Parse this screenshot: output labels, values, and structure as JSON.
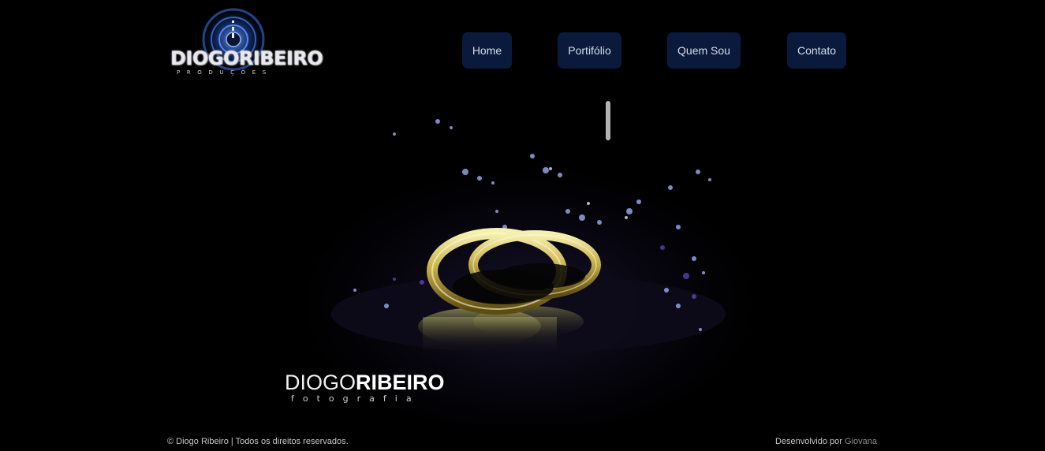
{
  "header": {
    "logo": {
      "wordmark": "DIOGORIBEIRO",
      "subtitle": "PRODUÇÕES"
    },
    "nav": [
      {
        "label": "Home"
      },
      {
        "label": "Portifólio"
      },
      {
        "label": "Quem Sou"
      },
      {
        "label": "Contato"
      }
    ]
  },
  "hero": {
    "brand_thin": "DIOGO",
    "brand_bold": "RIBEIRO",
    "brand_sub": "fotografia"
  },
  "footer": {
    "copyright": "© Diogo Ribeiro | Todos os direitos reservados.",
    "credit_prefix": "Desenvolvido por ",
    "credit_link": "Giovana"
  },
  "colors": {
    "background": "#000000",
    "nav_button": "#0a1a3c",
    "nav_text": "#d9dde8"
  }
}
